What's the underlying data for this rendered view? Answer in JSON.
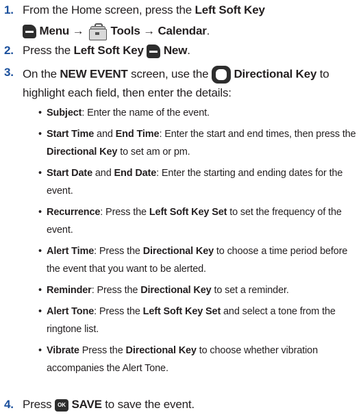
{
  "steps": [
    {
      "number": "1.",
      "line1": [
        "From the Home screen, press the ",
        "Left Soft Key"
      ],
      "line2": [
        "Menu",
        "→",
        "Tools",
        "→",
        "Calendar",
        "."
      ]
    },
    {
      "number": "2.",
      "line1": [
        "Press the ",
        "Left Soft Key",
        "New",
        "."
      ]
    },
    {
      "number": "3.",
      "line1": [
        "On the ",
        "NEW EVENT",
        " screen, use the ",
        "Directional Key",
        " to"
      ],
      "line2": "highlight each field, then enter the details:",
      "bullets": [
        {
          "lines": [
            [
              "Subject",
              ": Enter the name of the event."
            ]
          ]
        },
        {
          "lines": [
            [
              "Start Time",
              " and ",
              "End Time",
              ": Enter the start and end times, then press the"
            ],
            [
              "Directional Key",
              " to set am or pm."
            ]
          ]
        },
        {
          "lines": [
            [
              "Start Date",
              " and ",
              "End Date",
              ": Enter the starting and ending dates for the"
            ],
            [
              "event."
            ]
          ]
        },
        {
          "lines": [
            [
              "Recurrence",
              ": Press the ",
              "Left Soft Key Set",
              " to set the frequency of the"
            ],
            [
              "event."
            ]
          ]
        },
        {
          "lines": [
            [
              "Alert Time",
              ": Press the ",
              "Directional Key",
              " to choose a time period before"
            ],
            [
              "the event that you want to be alerted."
            ]
          ]
        },
        {
          "lines": [
            [
              "Reminder",
              ": Press the ",
              "Directional Key",
              " to set a reminder."
            ]
          ]
        },
        {
          "lines": [
            [
              "Alert Tone",
              ": Press the ",
              "Left Soft Key Set",
              " and select a tone from the"
            ],
            [
              "ringtone list."
            ]
          ]
        },
        {
          "lines": [
            [
              "Vibrate",
              " Press the ",
              "Directional Key",
              " to choose whether vibration"
            ],
            [
              "accompanies the Alert Tone."
            ]
          ]
        }
      ]
    },
    {
      "number": "4.",
      "line1": [
        "Press ",
        "OK",
        "SAVE",
        " to save the event."
      ]
    }
  ],
  "bullet_glyph": "•",
  "icons": {
    "left_soft_key": "left-soft-key-icon",
    "tools": "toolbox-icon",
    "directional_key": "directional-key-icon",
    "ok_key": "ok-key-icon"
  },
  "colors": {
    "step_number": "#1a4f9c",
    "text": "#231f20"
  }
}
